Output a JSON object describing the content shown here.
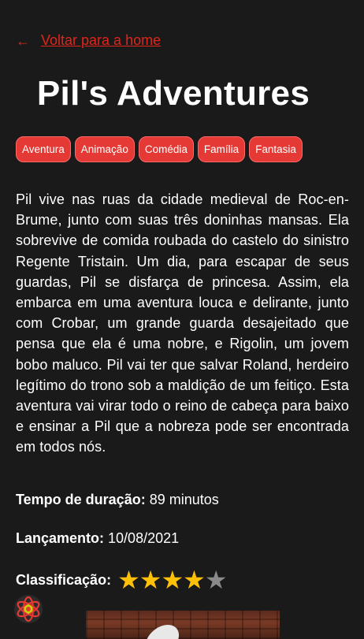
{
  "nav": {
    "back_arrow": "←",
    "back_label": "Voltar para a home"
  },
  "movie": {
    "title": "Pil's Adventures",
    "genres": [
      "Aventura",
      "Animação",
      "Comédia",
      "Família",
      "Fantasia"
    ],
    "synopsis": "Pil vive nas ruas da cidade medieval de Roc-en-Brume, junto com suas três doninhas mansas. Ela sobrevive de comida roubada do castelo do sinistro Regente Tristain. Um dia, para escapar de seus guardas, Pil se disfarça de princesa. Assim, ela embarca em uma aventura louca e delirante, junto com Crobar, um grande guarda desajeitado que pensa que ela é uma nobre, e Rigolin, um jovem bobo maluco. Pil vai ter que salvar Roland, herdeiro legítimo do trono sob a maldição de um feitiço. Esta aventura vai virar todo o reino de cabeça para baixo e ensinar a Pil que a nobreza pode ser encontrada em todos nós.",
    "duration_label": "Tempo de duração:",
    "duration_value": " 89 minutos",
    "release_label": "Lançamento:",
    "release_value": " 10/08/2021",
    "rating_label": "Classificação:",
    "rating_value": 4,
    "rating_max": 5
  },
  "colors": {
    "background": "#1a1a1a",
    "accent": "#e1251b",
    "genre_chip": "#e53935",
    "star_on": "#ffc107",
    "star_off": "#8a8a8a"
  },
  "icons": {
    "back": "arrow-left-icon",
    "star": "star-icon",
    "app": "react-atom-icon"
  }
}
